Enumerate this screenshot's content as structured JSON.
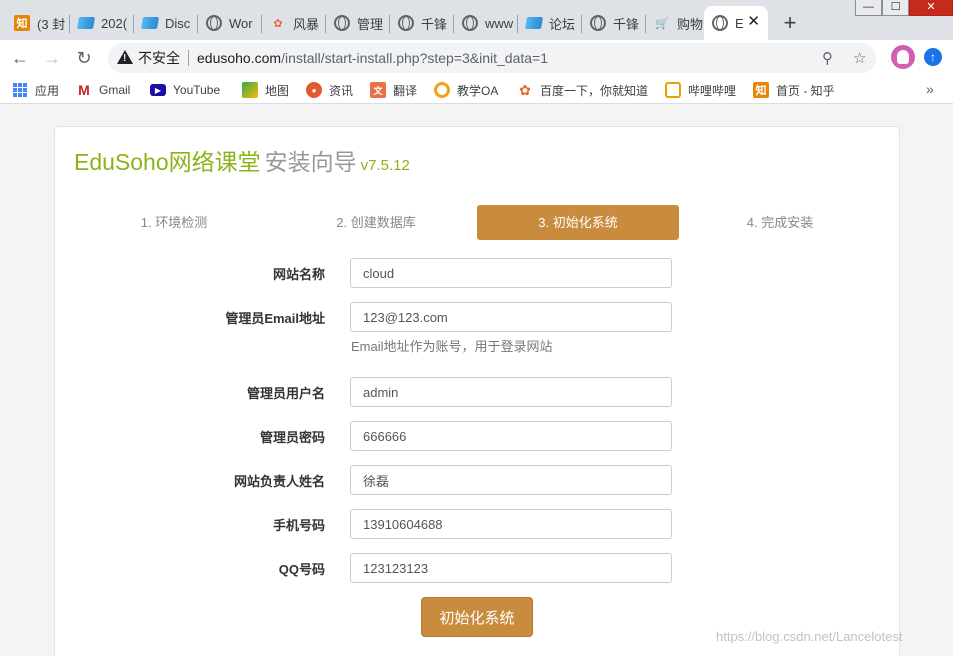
{
  "browser": {
    "tabs": [
      {
        "title": "(3 封",
        "icon": "zhihu-icon"
      },
      {
        "title": "202(",
        "icon": "hotspot-icon"
      },
      {
        "title": "Disc",
        "icon": "hotspot-icon"
      },
      {
        "title": "Wor",
        "icon": "globe-icon"
      },
      {
        "title": "风暴",
        "icon": "baidu-paw-icon"
      },
      {
        "title": "管理",
        "icon": "globe-icon"
      },
      {
        "title": "千锋",
        "icon": "globe-icon"
      },
      {
        "title": "www",
        "icon": "globe-icon"
      },
      {
        "title": "论坛",
        "icon": "hotspot-icon"
      },
      {
        "title": "千锋",
        "icon": "globe-icon"
      },
      {
        "title": "购物",
        "icon": "cart-icon"
      },
      {
        "title": "E",
        "icon": "globe-icon"
      }
    ],
    "new_tab": "+",
    "close_tab": "✕",
    "window": {
      "minimize": "—",
      "maximize": "☐",
      "close": "✕"
    },
    "nav": {
      "back": "←",
      "forward": "→",
      "reload": "↻"
    },
    "security_label": "不安全",
    "url_host": "edusoho.com",
    "url_rest": "/install/start-install.php?step=3&init_data=1",
    "bookmarks": [
      {
        "label": "应用",
        "icon": "apps-icon"
      },
      {
        "label": "Gmail",
        "icon": "gmail-icon"
      },
      {
        "label": "YouTube",
        "icon": "youtube-icon"
      },
      {
        "label": "地图",
        "icon": "maps-icon"
      },
      {
        "label": "资讯",
        "icon": "news-icon"
      },
      {
        "label": "翻译",
        "icon": "translate-icon"
      },
      {
        "label": "教学OA",
        "icon": "oa-icon"
      },
      {
        "label": "百度一下，你就知道",
        "icon": "baidu-icon"
      },
      {
        "label": "哔哩哔哩",
        "icon": "bilibili-icon"
      },
      {
        "label": "首页 - 知乎",
        "icon": "zhihu-icon"
      }
    ],
    "more_bookmarks": "»"
  },
  "page": {
    "brand_name": "EduSoho网络课堂",
    "brand_sub": "安装向导",
    "version": "v7.5.12",
    "steps": [
      {
        "label": "1. 环境检测",
        "active": false
      },
      {
        "label": "2. 创建数据库",
        "active": false
      },
      {
        "label": "3. 初始化系统",
        "active": true
      },
      {
        "label": "4. 完成安装",
        "active": false
      }
    ],
    "form": {
      "site_name": {
        "label": "网站名称",
        "value": "cloud"
      },
      "admin_email": {
        "label": "管理员Email地址",
        "value": "123@123.com",
        "help": "Email地址作为账号，用于登录网站"
      },
      "admin_username": {
        "label": "管理员用户名",
        "value": "admin"
      },
      "admin_password": {
        "label": "管理员密码",
        "value": "666666"
      },
      "owner_name": {
        "label": "网站负责人姓名",
        "value": "徐磊"
      },
      "phone": {
        "label": "手机号码",
        "value": "13910604688"
      },
      "qq": {
        "label": "QQ号码",
        "value": "123123123"
      }
    },
    "submit_label": "初始化系统",
    "watermark": "https://blog.csdn.net/Lancelotest"
  },
  "colors": {
    "brand_green": "#8cb31b",
    "accent_brown": "#c98b3e"
  }
}
